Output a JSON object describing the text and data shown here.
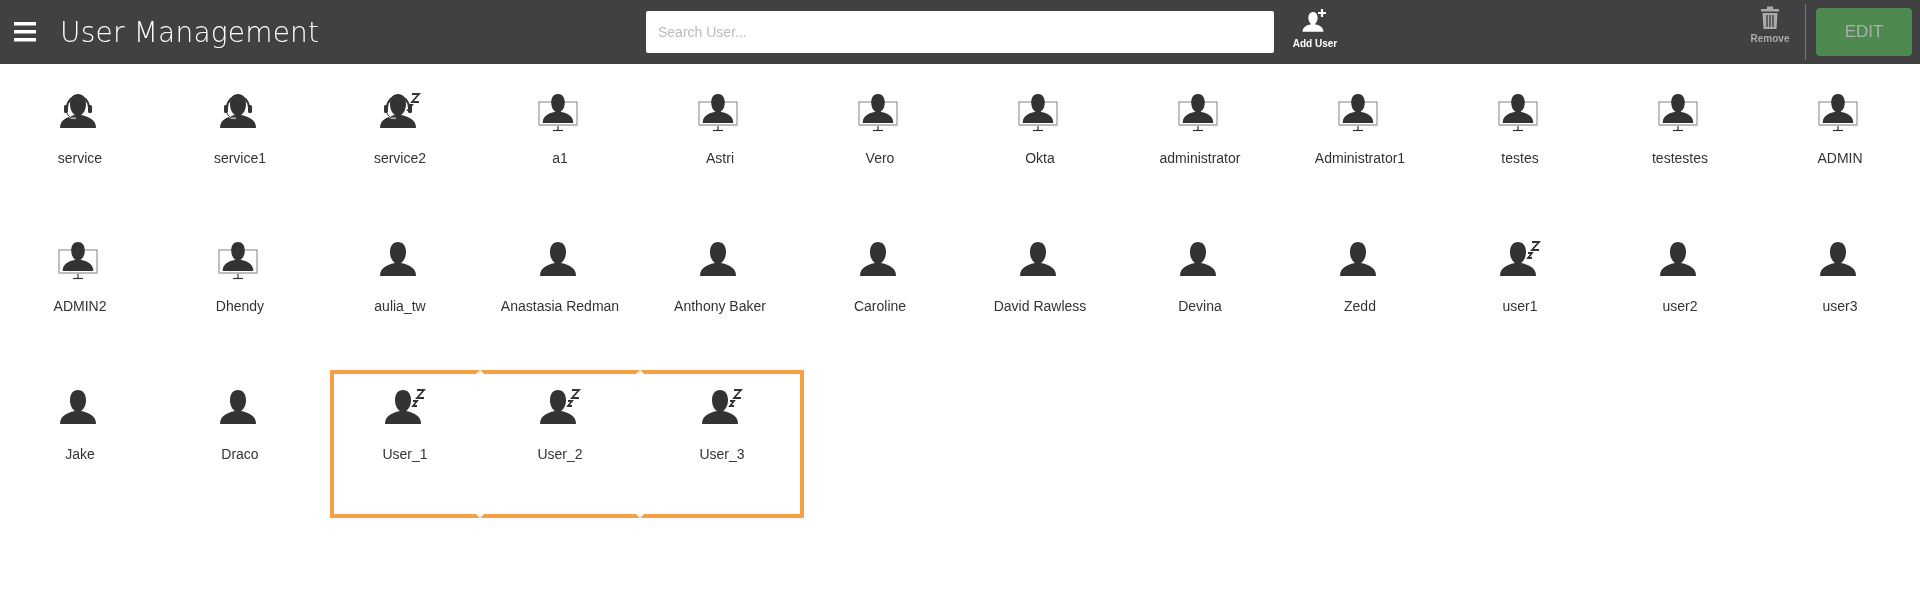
{
  "header": {
    "title": "User Management",
    "search": {
      "placeholder": "Search User..."
    },
    "add_button": {
      "label": "Add User"
    },
    "remove_button": {
      "label": "Remove",
      "disabled": true
    },
    "edit_button": {
      "label": "EDIT",
      "disabled": true
    }
  },
  "users": [
    {
      "name": "service",
      "kind": "agent",
      "idle": false,
      "highlighted": false
    },
    {
      "name": "service1",
      "kind": "agent",
      "idle": false,
      "highlighted": false
    },
    {
      "name": "service2",
      "kind": "agent",
      "idle": true,
      "highlighted": false
    },
    {
      "name": "a1",
      "kind": "monitor",
      "idle": false,
      "highlighted": false
    },
    {
      "name": "Astri",
      "kind": "monitor",
      "idle": false,
      "highlighted": false
    },
    {
      "name": "Vero",
      "kind": "monitor",
      "idle": false,
      "highlighted": false
    },
    {
      "name": "Okta",
      "kind": "monitor",
      "idle": false,
      "highlighted": false
    },
    {
      "name": "administrator",
      "kind": "monitor",
      "idle": false,
      "highlighted": false
    },
    {
      "name": "Administrator1",
      "kind": "monitor",
      "idle": false,
      "highlighted": false
    },
    {
      "name": "testes",
      "kind": "monitor",
      "idle": false,
      "highlighted": false
    },
    {
      "name": "testestes",
      "kind": "monitor",
      "idle": false,
      "highlighted": false
    },
    {
      "name": "ADMIN",
      "kind": "monitor",
      "idle": false,
      "highlighted": false
    },
    {
      "name": "ADMIN2",
      "kind": "monitor",
      "idle": false,
      "highlighted": false
    },
    {
      "name": "Dhendy",
      "kind": "monitor",
      "idle": false,
      "highlighted": false
    },
    {
      "name": "aulia_tw",
      "kind": "user",
      "idle": false,
      "highlighted": false
    },
    {
      "name": "Anastasia Redman",
      "kind": "user",
      "idle": false,
      "highlighted": false
    },
    {
      "name": "Anthony Baker",
      "kind": "user",
      "idle": false,
      "highlighted": false
    },
    {
      "name": "Caroline",
      "kind": "user",
      "idle": false,
      "highlighted": false
    },
    {
      "name": "David Rawless",
      "kind": "user",
      "idle": false,
      "highlighted": false
    },
    {
      "name": "Devina",
      "kind": "user",
      "idle": false,
      "highlighted": false
    },
    {
      "name": "Zedd",
      "kind": "user",
      "idle": false,
      "highlighted": false
    },
    {
      "name": "user1",
      "kind": "user",
      "idle": true,
      "highlighted": false
    },
    {
      "name": "user2",
      "kind": "user",
      "idle": false,
      "highlighted": false
    },
    {
      "name": "user3",
      "kind": "user",
      "idle": false,
      "highlighted": false
    },
    {
      "name": "Jake",
      "kind": "user",
      "idle": false,
      "highlighted": false
    },
    {
      "name": "Draco",
      "kind": "user",
      "idle": false,
      "highlighted": false
    },
    {
      "name": "User_1",
      "kind": "user",
      "idle": true,
      "highlighted": true
    },
    {
      "name": "User_2",
      "kind": "user",
      "idle": true,
      "highlighted": true
    },
    {
      "name": "User_3",
      "kind": "user",
      "idle": true,
      "highlighted": true
    }
  ]
}
